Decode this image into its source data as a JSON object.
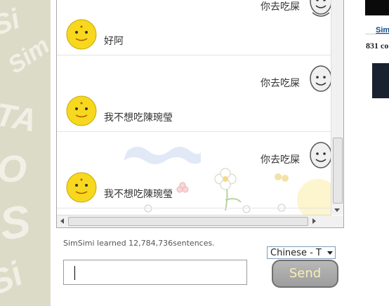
{
  "chat": {
    "messages": [
      {
        "speaker": "user",
        "text": "你去吃屎"
      },
      {
        "speaker": "simsimi",
        "text": "好阿"
      },
      {
        "speaker": "user",
        "text": "你去吃屎"
      },
      {
        "speaker": "simsimi",
        "text": "我不想吃陳琬瑩"
      },
      {
        "speaker": "user",
        "text": "你去吃屎"
      },
      {
        "speaker": "simsimi",
        "text": "我不想吃陳琬瑩"
      }
    ]
  },
  "status": {
    "learned_text": "SimSimi learned 12,784,736sentences."
  },
  "language": {
    "selected": "Chinese - T"
  },
  "input": {
    "value": ""
  },
  "send": {
    "label": "Send"
  },
  "side": {
    "link_text": "Sim",
    "count_text": "831 co"
  },
  "colors": {
    "send_button": "#a5a5a5",
    "send_text": "#f7efb6",
    "simsimi_face": "#f7d81e",
    "sidebar_background": "#dcdbc8"
  }
}
